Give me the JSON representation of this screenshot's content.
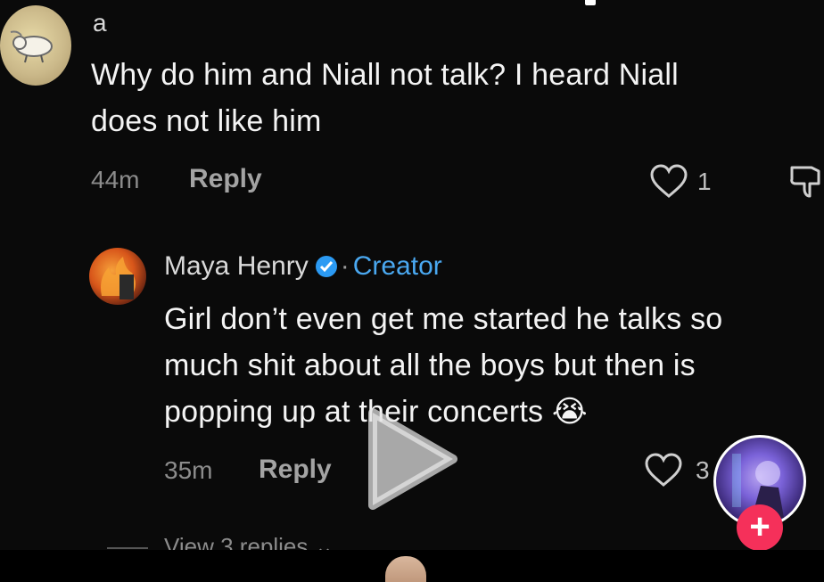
{
  "comment1": {
    "username": "a",
    "text_line1": "Why do him and Niall not talk? I heard Niall",
    "text_line2": "does not like him",
    "time": "44m",
    "reply_label": "Reply",
    "likes": "1",
    "avatar_icon": "sheep-avatar"
  },
  "comment2": {
    "username": "Maya Henry",
    "badge_icon": "verified-icon",
    "separator": "·",
    "role": "Creator",
    "text_line1": "Girl don’t even get me started he talks so",
    "text_line2": "much shit about all the boys but then is",
    "text_line3": "popping up at their concerts",
    "emoji": "😭",
    "time": "35m",
    "reply_label": "Reply",
    "likes": "3",
    "avatar_icon": "fire-avatar"
  },
  "view_replies": "View 3 replies",
  "colors": {
    "background": "#0a0a0a",
    "accent_blue": "#4aa8f0",
    "plus_red": "#f5305a"
  },
  "icons": {
    "like": "heart-outline-icon",
    "dislike": "thumbs-down-icon",
    "play": "play-icon",
    "follow": "plus-icon"
  }
}
